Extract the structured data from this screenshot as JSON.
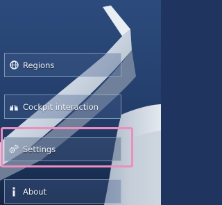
{
  "menu": {
    "items": [
      {
        "label": "Regions",
        "icon": "globe-icon"
      },
      {
        "label": "Cockpit interaction",
        "icon": "hands-icon"
      },
      {
        "label": "Settings",
        "icon": "gears-icon"
      },
      {
        "label": "About",
        "icon": "info-icon"
      }
    ],
    "selected_index": 2
  },
  "colors": {
    "highlight": "#ec8fbf",
    "sky_top": "#2b4a7c",
    "sky_bottom": "#16284a",
    "wing": "#dfe6ee"
  }
}
